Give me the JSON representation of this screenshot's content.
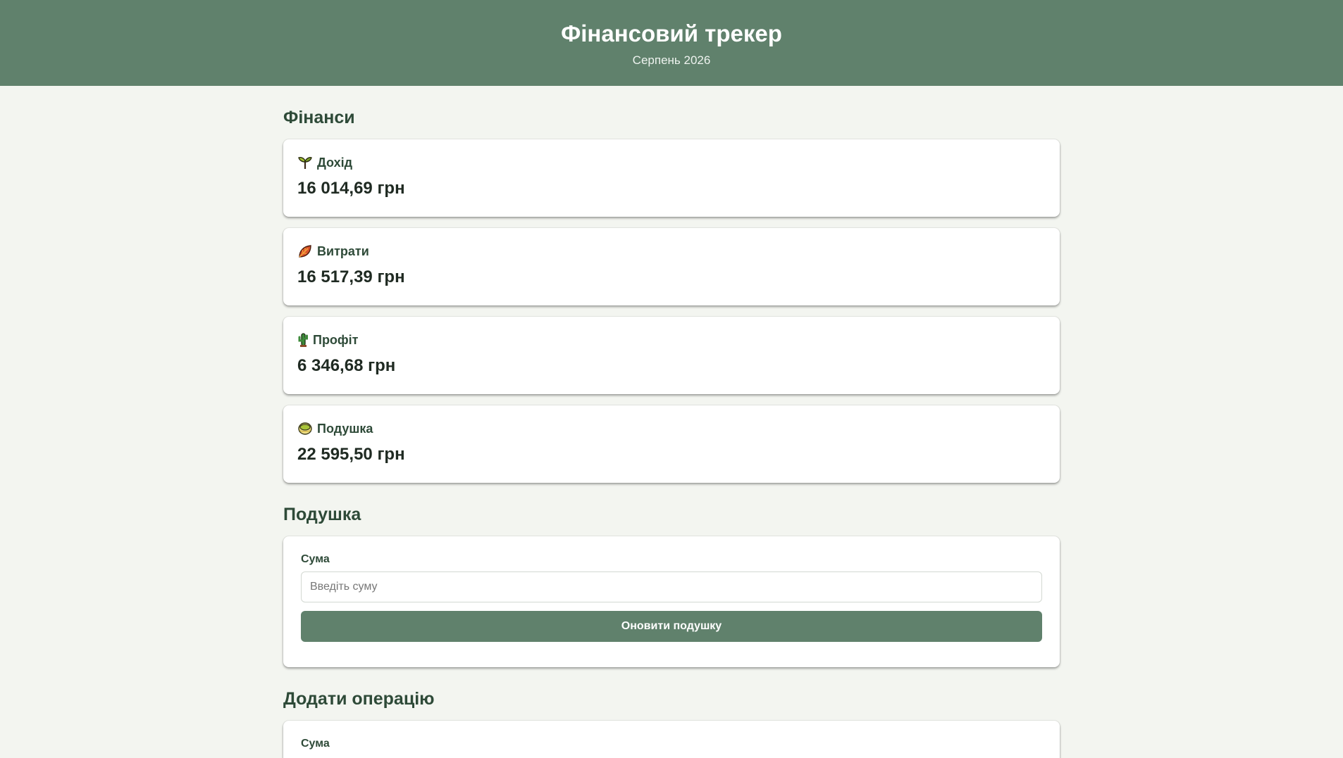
{
  "header": {
    "title": "Фінансовий трекер",
    "subtitle": "Серпень 2026"
  },
  "finance": {
    "title": "Фінанси",
    "cards": [
      {
        "label": "Дохід",
        "value": "16 014,69 грн",
        "icon": "sprout-icon"
      },
      {
        "label": "Витрати",
        "value": "16 517,39 грн",
        "icon": "fallen-leaf-icon"
      },
      {
        "label": "Профіт",
        "value": "6 346,68 грн",
        "icon": "cactus-icon"
      },
      {
        "label": "Подушка",
        "value": "22 595,50 грн",
        "icon": "cushion-icon"
      }
    ]
  },
  "cushion": {
    "title": "Подушка",
    "amount_label": "Сума",
    "amount_placeholder": "Введіть суму",
    "amount_value": "",
    "update_button": "Оновити подушку"
  },
  "add_operation": {
    "title": "Додати операцію",
    "amount_label": "Сума"
  },
  "colors": {
    "accent": "#60816c",
    "background": "#f3f5f0",
    "heading": "#2e4a38"
  }
}
